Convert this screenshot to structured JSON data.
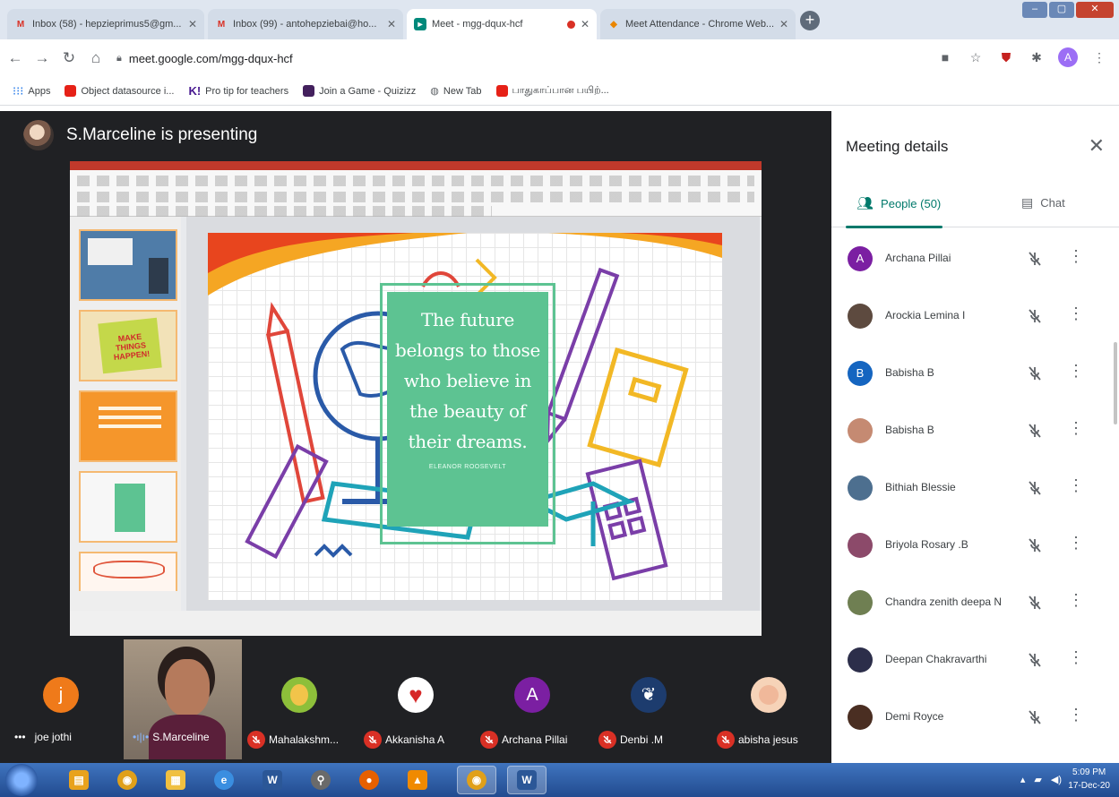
{
  "browser": {
    "tabs": [
      {
        "title": "Inbox (58) - hepzieprimus5@gm...",
        "icon": "gmail-icon",
        "color": "#d93025"
      },
      {
        "title": "Inbox (99) - antohepziebai@ho...",
        "icon": "gmail-icon",
        "color": "#d93025"
      },
      {
        "title": "Meet - mgg-dqux-hcf",
        "icon": "meet-icon",
        "color": "#00897b",
        "active": true,
        "recording": true
      },
      {
        "title": "Meet Attendance - Chrome Web...",
        "icon": "meet-attendance-icon",
        "color": "#ea8600"
      }
    ],
    "url": "meet.google.com/mgg-dqux-hcf",
    "bookmarks": [
      {
        "label": "Apps",
        "icon": "apps-grid-icon"
      },
      {
        "label": "Object datasource i...",
        "icon": "youtube-icon"
      },
      {
        "label": "Pro tip for teachers",
        "icon": "kahoot-icon"
      },
      {
        "label": "Join a Game - Quizizz",
        "icon": "quizizz-icon"
      },
      {
        "label": "New Tab",
        "icon": "globe-icon"
      },
      {
        "label": "பாதுகாப்பான பயிற்...",
        "icon": "youtube-icon"
      }
    ],
    "profile_letter": "A"
  },
  "meet": {
    "presenter_text": "S.Marceline is presenting",
    "slide": {
      "quote_lines": [
        "The future",
        "belongs to those",
        "who believe in",
        "the beauty of",
        "their dreams."
      ],
      "author": "ELEANOR ROOSEVELT"
    },
    "thumbnails": [
      {
        "text": "",
        "bg": "#4f7ca8"
      },
      {
        "text": "MAKE THINGS HAPPEN!",
        "bg": "#c4d84a"
      },
      {
        "text": "",
        "bg": "#f5962b"
      },
      {
        "text": "",
        "bg": "#f7f7f7"
      },
      {
        "text": "",
        "bg": "#fff6f0"
      }
    ],
    "tiles": [
      {
        "name": "joe jothi",
        "initial": "j",
        "avatar_color": "#ef7a1a",
        "muted": false
      },
      {
        "name": "S.Marceline",
        "initial": "",
        "avatar_color": "",
        "muted": false
      },
      {
        "name": "Mahalakshm...",
        "initial": "",
        "avatar_color": "#8dbf3a",
        "muted": true
      },
      {
        "name": "Akkanisha A",
        "initial": "",
        "avatar_color": "#ffffff",
        "muted": true
      },
      {
        "name": "Archana Pillai",
        "initial": "A",
        "avatar_color": "#7b1fa2",
        "muted": true
      },
      {
        "name": "Denbi .M",
        "initial": "",
        "avatar_color": "#1d3c6e",
        "muted": true
      },
      {
        "name": "abisha jesus",
        "initial": "",
        "avatar_color": "#f6d3b8",
        "muted": true
      }
    ],
    "more_label": "•••"
  },
  "side_panel": {
    "title": "Meeting details",
    "tab_people": "People (50)",
    "tab_chat": "Chat",
    "people": [
      {
        "name": "Archana Pillai",
        "initial": "A",
        "color": "#7b1fa2"
      },
      {
        "name": "Arockia Lemina I",
        "initial": "",
        "color": "#5d4a3f"
      },
      {
        "name": "Babisha B",
        "initial": "B",
        "color": "#1565c0"
      },
      {
        "name": "Babisha B",
        "initial": "",
        "color": "#c58a72"
      },
      {
        "name": "Bithiah Blessie",
        "initial": "",
        "color": "#4d6f8f"
      },
      {
        "name": "Briyola Rosary .B",
        "initial": "",
        "color": "#8c4a6a"
      },
      {
        "name": "Chandra zenith deepa N",
        "initial": "",
        "color": "#6f7f52"
      },
      {
        "name": "Deepan Chakravarthi",
        "initial": "",
        "color": "#2c2e4a"
      },
      {
        "name": "Demi Royce",
        "initial": "",
        "color": "#4a2e22"
      }
    ]
  },
  "taskbar": {
    "apps": [
      {
        "icon": "windows-explorer-icon",
        "color": "#e8a21d",
        "glyph": "▤"
      },
      {
        "icon": "chrome-icon",
        "color": "#e0a019",
        "glyph": "◉"
      },
      {
        "icon": "folder-icon",
        "color": "#f0c040",
        "glyph": "▦"
      },
      {
        "icon": "internet-explorer-icon",
        "color": "#3a8ee0",
        "glyph": "e"
      },
      {
        "icon": "word-icon",
        "color": "#2b5797",
        "glyph": "W"
      },
      {
        "icon": "search-program-icon",
        "color": "#6a6a6a",
        "glyph": "⚲"
      },
      {
        "icon": "firefox-icon",
        "color": "#e66000",
        "glyph": "●"
      },
      {
        "icon": "vlc-icon",
        "color": "#f08a00",
        "glyph": "▲"
      },
      {
        "icon": "chrome-icon",
        "color": "#e0a019",
        "glyph": "◉",
        "active": true
      },
      {
        "icon": "word-icon",
        "color": "#2b5797",
        "glyph": "W",
        "active": true
      }
    ],
    "time": "5:09 PM",
    "date": "17-Dec-20"
  }
}
